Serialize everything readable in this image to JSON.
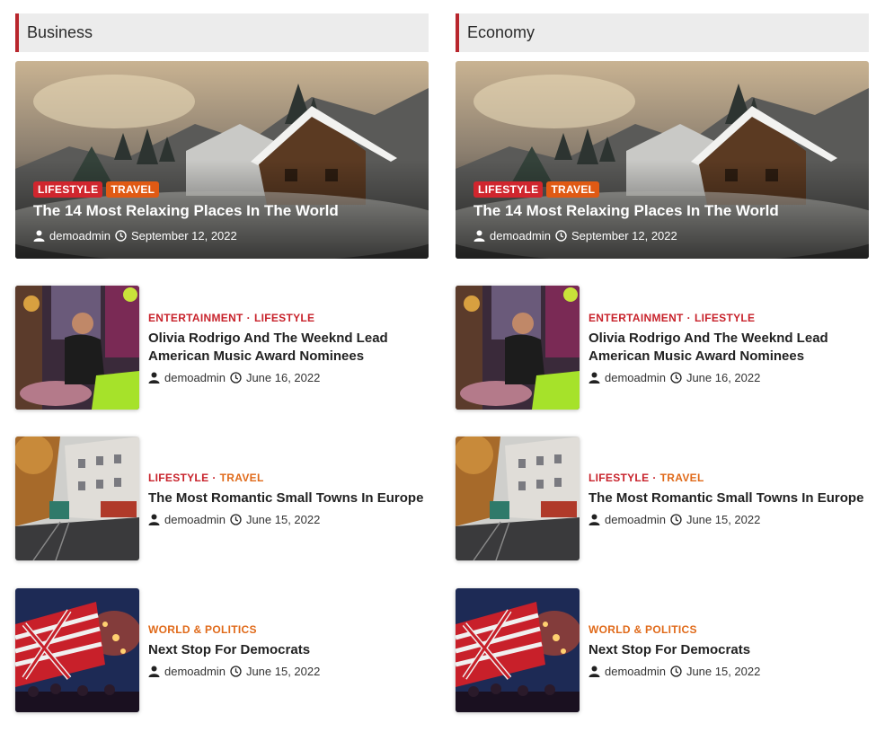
{
  "colors": {
    "accent": "#b8262d",
    "badge_red": "#d0262e",
    "badge_orange": "#e05a14",
    "cat_orange": "#e06a1a"
  },
  "columns": [
    {
      "header": "Business",
      "hero": {
        "badges": [
          "LIFESTYLE",
          "TRAVEL"
        ],
        "title": "The 14 Most Relaxing Places In The World",
        "author": "demoadmin",
        "date": "September 12, 2022"
      },
      "posts": [
        {
          "cat1": "ENTERTAINMENT",
          "cat2": "LIFESTYLE",
          "title": "Olivia Rodrigo And The Weeknd Lead American Music Award Nominees",
          "author": "demoadmin",
          "date": "June 16, 2022"
        },
        {
          "cat1": "LIFESTYLE",
          "cat2": "TRAVEL",
          "title": "The Most Romantic Small Towns In Europe",
          "author": "demoadmin",
          "date": "June 15, 2022"
        },
        {
          "cat1": "WORLD & POLITICS",
          "title": "Next Stop For Democrats",
          "author": "demoadmin",
          "date": "June 15, 2022"
        }
      ]
    },
    {
      "header": "Economy",
      "hero": {
        "badges": [
          "LIFESTYLE",
          "TRAVEL"
        ],
        "title": "The 14 Most Relaxing Places In The World",
        "author": "demoadmin",
        "date": "September 12, 2022"
      },
      "posts": [
        {
          "cat1": "ENTERTAINMENT",
          "cat2": "LIFESTYLE",
          "title": "Olivia Rodrigo And The Weeknd Lead American Music Award Nominees",
          "author": "demoadmin",
          "date": "June 16, 2022"
        },
        {
          "cat1": "LIFESTYLE",
          "cat2": "TRAVEL",
          "title": "The Most Romantic Small Towns In Europe",
          "author": "demoadmin",
          "date": "June 15, 2022"
        },
        {
          "cat1": "WORLD & POLITICS",
          "title": "Next Stop For Democrats",
          "author": "demoadmin",
          "date": "June 15, 2022"
        }
      ]
    }
  ]
}
